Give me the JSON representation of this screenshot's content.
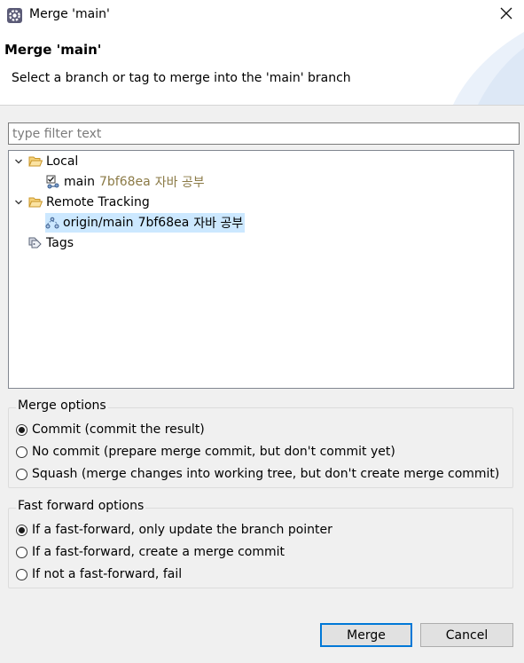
{
  "window": {
    "title": "Merge 'main'",
    "icon": "eclipse-gear-icon",
    "close_icon": "close-icon"
  },
  "header": {
    "title": "Merge 'main'",
    "description": "Select a branch or tag to merge into the 'main' branch"
  },
  "filter": {
    "placeholder": "type filter text",
    "value": ""
  },
  "tree": {
    "local": {
      "label": "Local",
      "expanded": true,
      "children": [
        {
          "name": "main",
          "commit": "7bf68ea",
          "message": "자바 공부",
          "icon": "branch-checked-out-icon"
        }
      ]
    },
    "remote": {
      "label": "Remote Tracking",
      "expanded": true,
      "children": [
        {
          "name": "origin/main",
          "commit": "7bf68ea",
          "message": "자바 공부",
          "icon": "remote-branch-icon",
          "selected": true
        }
      ]
    },
    "tags": {
      "label": "Tags",
      "icon": "tags-icon"
    }
  },
  "merge_options": {
    "title": "Merge options",
    "options": [
      {
        "label": "Commit (commit the result)",
        "selected": true
      },
      {
        "label": "No commit (prepare merge commit, but don't commit yet)",
        "selected": false
      },
      {
        "label": "Squash (merge changes into working tree, but don't create merge commit)",
        "selected": false
      }
    ]
  },
  "ff_options": {
    "title": "Fast forward options",
    "options": [
      {
        "label": "If a fast-forward, only update the branch pointer",
        "selected": true
      },
      {
        "label": "If a fast-forward, create a merge commit",
        "selected": false
      },
      {
        "label": "If not a fast-forward, fail",
        "selected": false
      }
    ]
  },
  "buttons": {
    "merge": "Merge",
    "cancel": "Cancel"
  },
  "colors": {
    "accent": "#0078d7",
    "selection": "#cce8ff",
    "commit_hash": "#8b7a46",
    "folder": "#e8b94a"
  }
}
